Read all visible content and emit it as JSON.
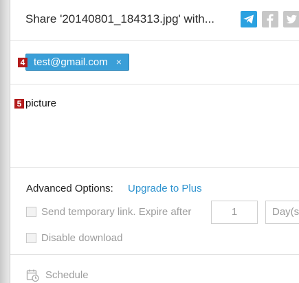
{
  "dialog": {
    "title": "Share '20140801_184313.jpg' with...",
    "share_icons": [
      "telegram-icon",
      "facebook-icon",
      "twitter-icon"
    ]
  },
  "recipients": {
    "badge": "4",
    "chip_label": "test@gmail.com",
    "chip_remove": "×"
  },
  "message": {
    "badge": "5",
    "text": "picture"
  },
  "advanced": {
    "label": "Advanced Options:",
    "upgrade_link": "Upgrade to Plus",
    "temp_link_label": "Send temporary link. Expire after",
    "expire_value": "1",
    "expire_unit": "Day(s)",
    "disable_download_label": "Disable download"
  },
  "schedule": {
    "label": "Schedule"
  },
  "colors": {
    "accent": "#2e93cf",
    "chip": "#3a9fd8",
    "badge": "#b31b1b",
    "disabled_text": "#9d9d9d"
  }
}
